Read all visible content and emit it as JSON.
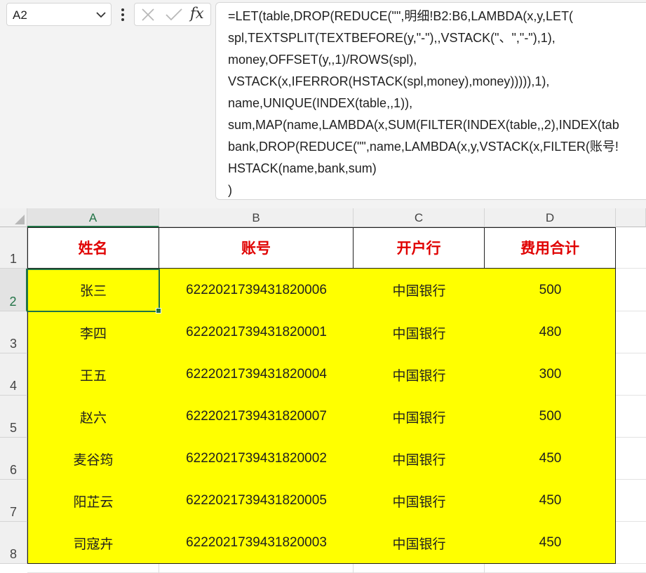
{
  "name_box": {
    "value": "A2"
  },
  "formula_bar": {
    "fx_label": "fx",
    "lines": [
      "=LET(table,DROP(REDUCE(\"\",明细!B2:B6,LAMBDA(x,y,LET(",
      "spl,TEXTSPLIT(TEXTBEFORE(y,\"-\"),,VSTACK(\"、\",\"-\"),1),",
      "money,OFFSET(y,,1)/ROWS(spl),",
      "VSTACK(x,IFERROR(HSTACK(spl,money),money))))),1),",
      "name,UNIQUE(INDEX(table,,1)),",
      "sum,MAP(name,LAMBDA(x,SUM(FILTER(INDEX(table,,2),INDEX(tab",
      "bank,DROP(REDUCE(\"\",name,LAMBDA(x,y,VSTACK(x,FILTER(账号!",
      "HSTACK(name,bank,sum)",
      ")"
    ]
  },
  "sheet": {
    "column_headers": [
      "A",
      "B",
      "C",
      "D"
    ],
    "row_headers": [
      "1",
      "2",
      "3",
      "4",
      "5",
      "6",
      "7",
      "8"
    ],
    "table_header": [
      "姓名",
      "账号",
      "开户行",
      "费用合计"
    ],
    "rows": [
      [
        "张三",
        "6222021739431820006",
        "中国银行",
        "500"
      ],
      [
        "李四",
        "6222021739431820001",
        "中国银行",
        "480"
      ],
      [
        "王五",
        "6222021739431820004",
        "中国银行",
        "300"
      ],
      [
        "赵六",
        "6222021739431820007",
        "中国银行",
        "500"
      ],
      [
        "麦谷筠",
        "6222021739431820002",
        "中国银行",
        "450"
      ],
      [
        "阳芷云",
        "6222021739431820005",
        "中国银行",
        "450"
      ],
      [
        "司寇卉",
        "6222021739431820003",
        "中国银行",
        "450"
      ]
    ]
  },
  "colors": {
    "header_text": "#e00000",
    "fill": "#ffff00",
    "selection": "#217346"
  }
}
